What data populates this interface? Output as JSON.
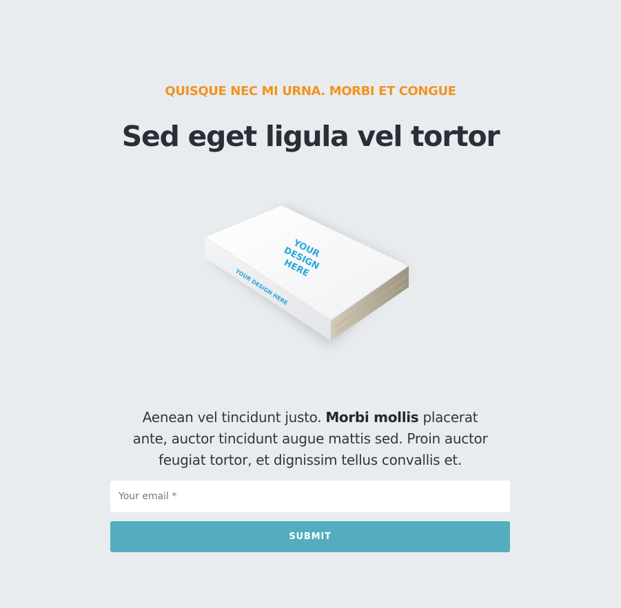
{
  "hero": {
    "eyebrow": "QUISQUE NEC MI URNA. MORBI ET CONGUE",
    "title": "Sed eget ligula vel tortor"
  },
  "book": {
    "cover_text": [
      "YOUR",
      "DESIGN",
      "HERE"
    ],
    "spine_text": "YOUR DESIGN HERE",
    "accent_color": "#2aa6dc"
  },
  "description": {
    "part1": "Aenean vel tincidunt justo. ",
    "bold": "Morbi mollis",
    "part2": " placerat ante, auctor tincidunt augue mattis sed. Proin auctor feugiat tortor, et dignissim tellus convallis et."
  },
  "form": {
    "email_placeholder": "Your email *",
    "email_value": "",
    "submit_label": "SUBMIT"
  },
  "colors": {
    "background": "#e9ecef",
    "eyebrow": "#f0931f",
    "button": "#53adbf"
  }
}
